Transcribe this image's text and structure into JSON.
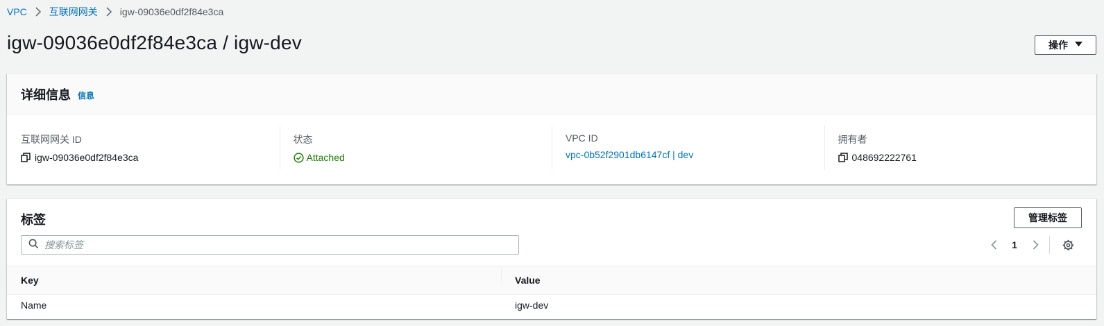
{
  "breadcrumb": {
    "items": [
      "VPC",
      "互联网网关"
    ],
    "current": "igw-09036e0df2f84e3ca"
  },
  "header": {
    "title": "igw-09036e0df2f84e3ca / igw-dev",
    "actions_label": "操作"
  },
  "details": {
    "title": "详细信息",
    "info_link": "信息",
    "fields": [
      {
        "label": "互联网网关 ID",
        "value": "igw-09036e0df2f84e3ca"
      },
      {
        "label": "状态",
        "value": "Attached"
      },
      {
        "label": "VPC ID",
        "value": "vpc-0b52f2901db6147cf | dev"
      },
      {
        "label": "拥有者",
        "value": "048692222761"
      }
    ]
  },
  "tags": {
    "title": "标签",
    "manage_label": "管理标签",
    "search_placeholder": "搜索标签",
    "page": "1",
    "columns": [
      "Key",
      "Value"
    ],
    "rows": [
      {
        "key": "Name",
        "value": "igw-dev"
      }
    ]
  },
  "colors": {
    "link": "#0073bb",
    "success": "#1d8102",
    "background": "#f2f3f3"
  },
  "icons": [
    "chevron-right-icon",
    "caret-down-icon",
    "copy-icon",
    "check-circle-icon",
    "search-icon",
    "chevron-left-icon",
    "gear-icon"
  ]
}
